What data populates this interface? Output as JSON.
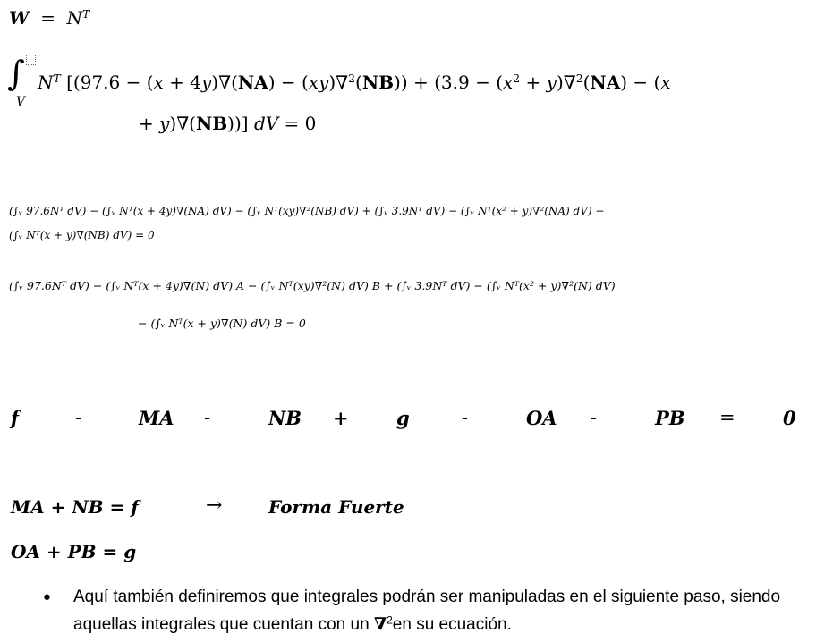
{
  "line_w": {
    "lhs": "W",
    "eq": "=",
    "rhs": "N",
    "sup": "T"
  },
  "weak_form": {
    "integral_sub": "V",
    "line1_parts": [
      "N",
      "T",
      " [(97.6  −  (𝑥 + 4𝑦)∇(",
      "NA",
      ")  −  (𝑥𝑦)∇",
      "2",
      "(",
      "NB",
      "))  +  (3.9  −  (𝑥",
      "2",
      " + 𝑦)∇",
      "2",
      "(",
      "NA",
      ")  −  (𝑥"
    ],
    "line2_parts": [
      "+ 𝑦)∇(",
      "NB",
      "))] 𝑑𝑉  =  0"
    ]
  },
  "expanded": {
    "row1": "(∫ᵥ 97.6Nᵀ dV) − (∫ᵥ Nᵀ(x + 4y)∇(NA) dV) − (∫ᵥ Nᵀ(xy)∇²(NB) dV) + (∫ᵥ 3.9Nᵀ dV) − (∫ᵥ Nᵀ(x² + y)∇²(NA) dV) −",
    "row2": "(∫ᵥ Nᵀ(x + y)∇(NB) dV) = 0"
  },
  "factored": {
    "row1": "(∫ᵥ 97.6Nᵀ dV) − (∫ᵥ Nᵀ(x + 4y)∇(N) dV) A − (∫ᵥ Nᵀ(xy)∇²(N) dV) B + (∫ᵥ 3.9Nᵀ dV) − (∫ᵥ Nᵀ(x² + y)∇²(N) dV)",
    "row2": "− (∫ᵥ Nᵀ(x + y)∇(N) dV) B = 0"
  },
  "matrix_row": [
    "f",
    "-",
    "MA",
    "-",
    "NB",
    "+",
    "g",
    "-",
    "OA",
    "-",
    "PB",
    "=",
    "0"
  ],
  "strong": {
    "eq1": "MA + NB = f",
    "arrow": "→",
    "label": "Forma Fuerte",
    "eq2": "OA + PB = g"
  },
  "bullet": {
    "line1": "Aquí también definiremos que integrales podrán ser manipuladas en el siguiente paso, siendo",
    "line2_a": "aquellas integrales que cuentan con un ",
    "nabla": "∇",
    "nabla_sup": "2",
    "line2_b": "en su ecuación."
  }
}
